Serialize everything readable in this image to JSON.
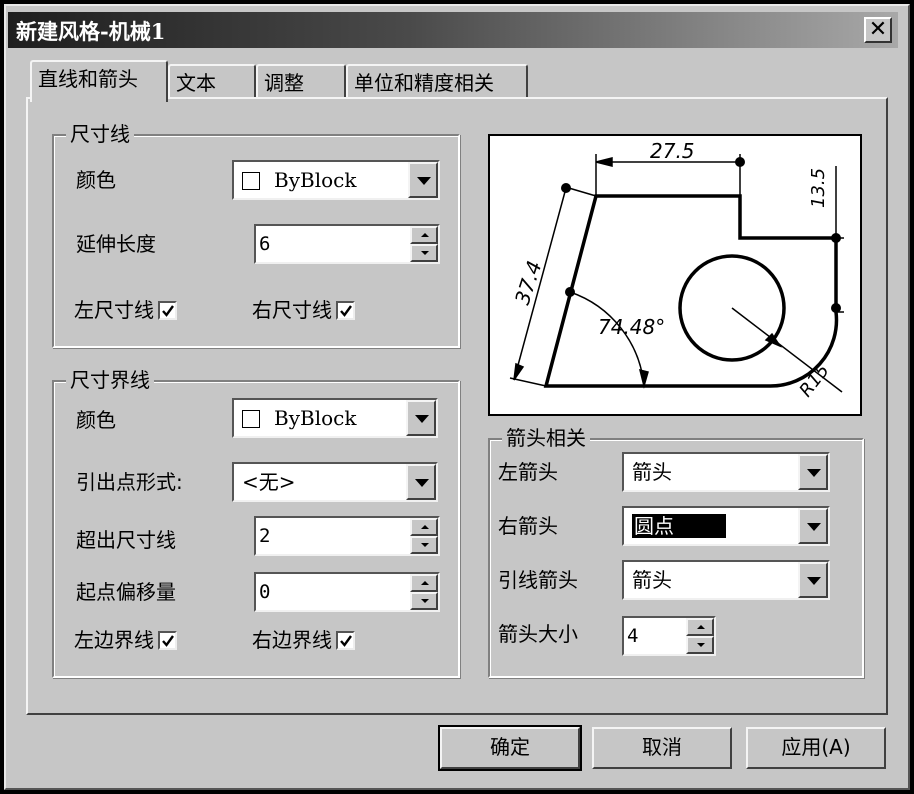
{
  "window": {
    "title": "新建风格-机械1",
    "close_label": "✕"
  },
  "tabs": [
    {
      "label": "直线和箭头",
      "active": true
    },
    {
      "label": "文本",
      "active": false
    },
    {
      "label": "调整",
      "active": false
    },
    {
      "label": "单位和精度相关",
      "active": false
    }
  ],
  "dimension_line": {
    "legend": "尺寸线",
    "color_label": "颜色",
    "color_value": "ByBlock",
    "extend_label": "延伸长度",
    "extend_value": "6",
    "left_label": "左尺寸线",
    "right_label": "右尺寸线",
    "left_checked": true,
    "right_checked": true
  },
  "extension_line": {
    "legend": "尺寸界线",
    "color_label": "颜色",
    "color_value": "ByBlock",
    "origin_form_label": "引出点形式:",
    "origin_form_value": "<无>",
    "beyond_label": "超出尺寸线",
    "beyond_value": "2",
    "offset_label": "起点偏移量",
    "offset_value": "0",
    "left_label": "左边界线",
    "right_label": "右边界线",
    "left_checked": true,
    "right_checked": true
  },
  "preview": {
    "dim_top": "27.5",
    "dim_right": "13.5",
    "dim_left": "37.4",
    "dim_angle": "74.48°",
    "dim_radius": "R15"
  },
  "arrow": {
    "legend": "箭头相关",
    "left_label": "左箭头",
    "left_value": "箭头",
    "right_label": "右箭头",
    "right_value": "圆点",
    "leader_label": "引线箭头",
    "leader_value": "箭头",
    "size_label": "箭头大小",
    "size_value": "4"
  },
  "buttons": {
    "ok": "确定",
    "cancel": "取消",
    "apply": "应用(A)"
  }
}
